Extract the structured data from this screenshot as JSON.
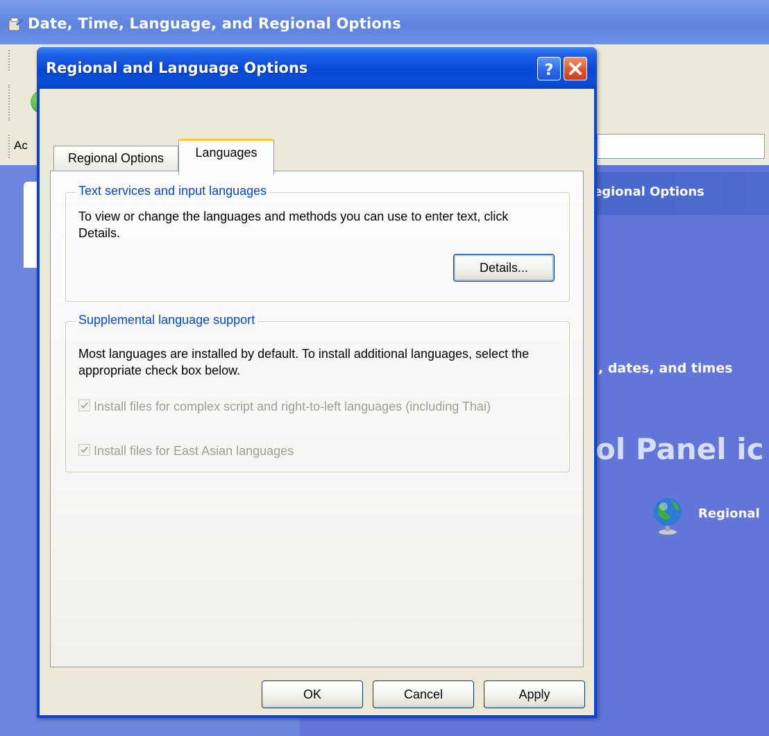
{
  "background_window": {
    "title": "Date, Time, Language, and Regional Options",
    "address_label": "Ac",
    "header_text": "egional Options",
    "task_text": ", dates, and times",
    "big_heading": "ol Panel ic",
    "globe_item_label": "Regional"
  },
  "dialog": {
    "title": "Regional and Language Options",
    "help_label": "?",
    "close_label": "×",
    "tabs": [
      {
        "label": "Regional Options",
        "selected": false
      },
      {
        "label": "Languages",
        "selected": true
      }
    ],
    "text_services": {
      "legend": "Text services and input languages",
      "description": "To view or change the languages and methods you can use to enter text, click Details.",
      "details_label": "Details..."
    },
    "supplemental": {
      "legend": "Supplemental language support",
      "description": "Most languages are installed by default. To install additional languages, select the appropriate check box below.",
      "checkboxes": [
        {
          "label": "Install files for complex script and right-to-left languages (including Thai)",
          "checked": true,
          "enabled": false
        },
        {
          "label": "Install files for East Asian languages",
          "checked": true,
          "enabled": false
        }
      ]
    },
    "buttons": {
      "ok": "OK",
      "cancel": "Cancel",
      "apply": "Apply"
    }
  },
  "colors": {
    "titlebar": "#0a44d6",
    "dialog_face": "#ece9d8",
    "legend_text": "#0046d5",
    "disabled_text": "#a09e93",
    "tab_highlight": "#ffc83c",
    "background_blue": "#6275d9"
  }
}
